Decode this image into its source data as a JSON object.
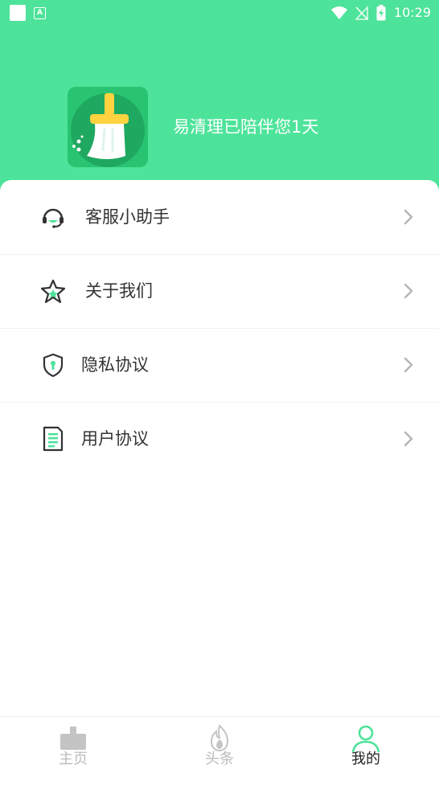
{
  "status_bar": {
    "time": "10:29"
  },
  "header": {
    "greeting": "易清理已陪伴您1天"
  },
  "menu": {
    "items": [
      {
        "label": "客服小助手",
        "icon": "headset-icon"
      },
      {
        "label": "关于我们",
        "icon": "star-icon"
      },
      {
        "label": "隐私协议",
        "icon": "shield-icon"
      },
      {
        "label": "用户协议",
        "icon": "document-icon"
      }
    ]
  },
  "tabbar": {
    "tabs": [
      {
        "label": "主页",
        "icon": "broom-icon",
        "active": false
      },
      {
        "label": "头条",
        "icon": "flame-icon",
        "active": false
      },
      {
        "label": "我的",
        "icon": "person-icon",
        "active": true
      }
    ]
  },
  "colors": {
    "brand": "#4de39a",
    "brand_dark": "#28c472",
    "broom_handle": "#ffd23f",
    "text": "#333333",
    "tab_inactive": "#bbbbbb",
    "tab_active": "#222222"
  }
}
